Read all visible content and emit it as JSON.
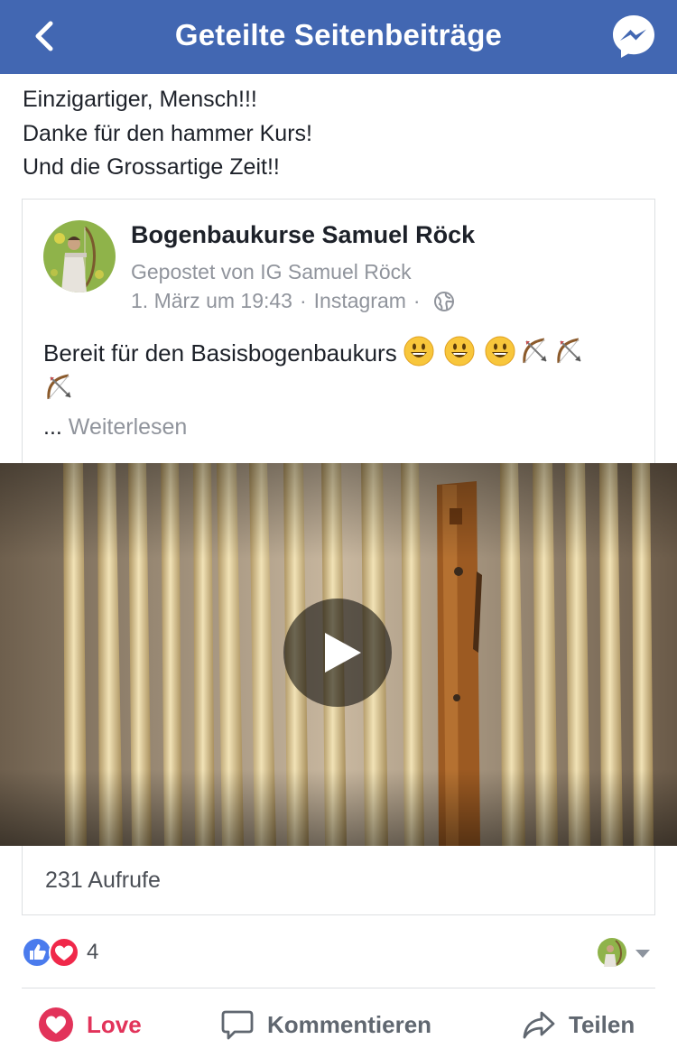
{
  "header": {
    "title": "Geteilte Seitenbeiträge",
    "back_icon": "chevron-left-icon",
    "messenger_icon": "messenger-icon"
  },
  "shared_text": {
    "lines": [
      "Einzigartiger, Mensch!!!",
      "Danke für den hammer Kurs!",
      "Und die Grossartige Zeit!!"
    ]
  },
  "post": {
    "page_name": "Bogenbaukurse Samuel Röck",
    "posted_by": "Gepostet von IG Samuel Röck",
    "date": "1. März um 19:43",
    "separator": "·",
    "source": "Instagram",
    "privacy_icon": "globe-icon",
    "text": "Bereit für den Basisbogenbaukurs",
    "emojis": [
      "smiley-emoji",
      "smiley-emoji",
      "smiley-emoji",
      "bow-and-arrow-emoji",
      "bow-and-arrow-emoji",
      "bow-and-arrow-emoji"
    ],
    "ellipsis": "...",
    "read_more": "Weiterlesen",
    "video": {
      "play_icon": "play-icon"
    },
    "views": "231 Aufrufe"
  },
  "reactions": {
    "icons": [
      "like-icon",
      "heart-icon"
    ],
    "count": "4"
  },
  "actions": {
    "love": "Love",
    "comment": "Kommentieren",
    "share": "Teilen"
  },
  "colors": {
    "header_bg": "#4267b2",
    "love": "#e2335a",
    "muted": "#90949c",
    "like_blue": "#4a7bed"
  }
}
